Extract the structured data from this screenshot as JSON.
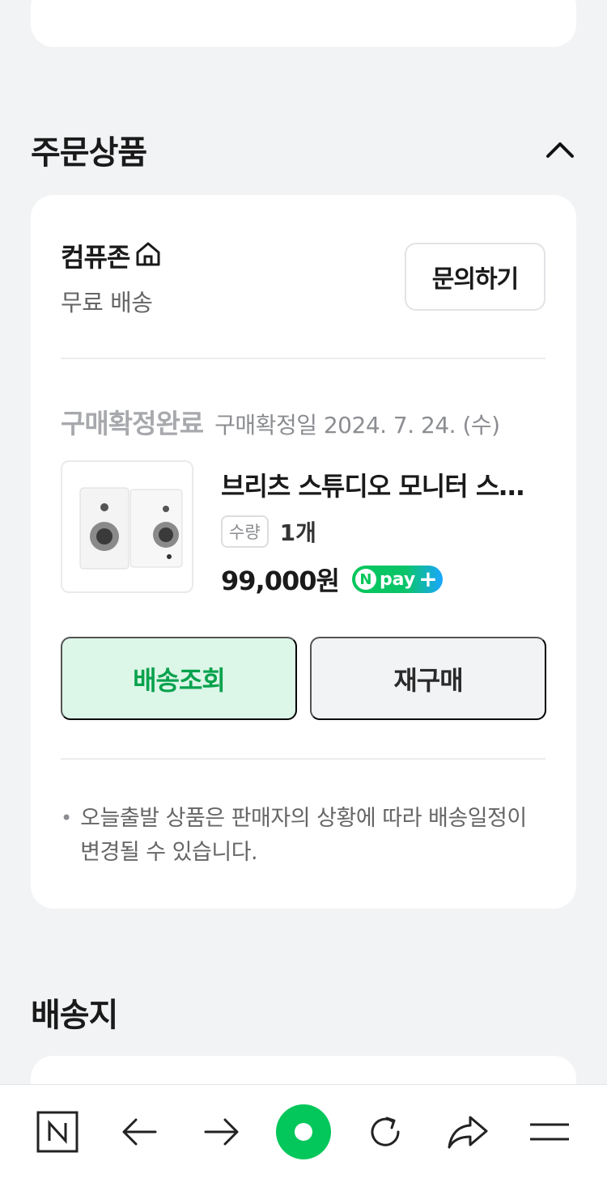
{
  "order_section": {
    "title": "주문상품",
    "seller": {
      "name": "컴퓨존",
      "shipping": "무료 배송",
      "inquiry_label": "문의하기"
    },
    "order": {
      "status": "구매확정완료",
      "confirm_date": "구매확정일 2024. 7. 24. (수)",
      "product_name": "브리츠 스튜디오 모니터 스피커",
      "qty_label": "수량",
      "qty_value": "1개",
      "price": "99,000원",
      "pay_badge": {
        "n": "N",
        "text": "pay",
        "plus": "+"
      },
      "track_label": "배송조회",
      "rebuy_label": "재구매"
    },
    "notice": "오늘출발 상품은 판매자의 상황에 따라 배송일정이 변경될 수 있습니다."
  },
  "delivery_section": {
    "title": "배송지"
  },
  "bottom_nav": {
    "items": [
      "naver-home-icon",
      "back-arrow-icon",
      "forward-arrow-icon",
      "green-dot-icon",
      "refresh-icon",
      "share-icon",
      "menu-icon"
    ]
  },
  "colors": {
    "accent_green": "#03c75a",
    "track_button_bg": "#dcf6e8",
    "track_button_text": "#08a24d",
    "background": "#f2f3f5"
  }
}
